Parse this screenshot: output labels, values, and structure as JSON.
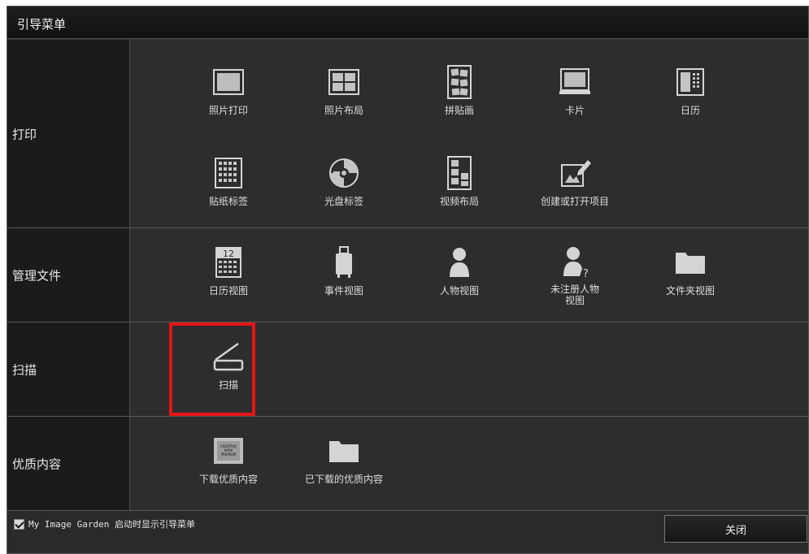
{
  "window": {
    "title": "引导菜单"
  },
  "sections": {
    "print": {
      "label": "打印",
      "items": [
        {
          "label": "照片打印",
          "icon": "photo-print-icon"
        },
        {
          "label": "照片布局",
          "icon": "photo-layout-icon"
        },
        {
          "label": "拼贴画",
          "icon": "collage-icon"
        },
        {
          "label": "卡片",
          "icon": "card-icon"
        },
        {
          "label": "日历",
          "icon": "calendar-icon"
        },
        {
          "label": "贴纸标签",
          "icon": "sticker-icon"
        },
        {
          "label": "光盘标签",
          "icon": "disc-label-icon"
        },
        {
          "label": "视频布局",
          "icon": "video-layout-icon"
        },
        {
          "label": "创建或打开项目",
          "icon": "create-open-item-icon"
        }
      ]
    },
    "manage": {
      "label": "管理文件",
      "items": [
        {
          "label": "日历视图",
          "icon": "calendar-view-icon",
          "day": "12"
        },
        {
          "label": "事件视图",
          "icon": "event-view-icon"
        },
        {
          "label": "人物视图",
          "icon": "people-view-icon"
        },
        {
          "label": "未注册人物\n视图",
          "icon": "unregistered-people-icon"
        },
        {
          "label": "文件夹视图",
          "icon": "folder-view-icon"
        }
      ]
    },
    "scan": {
      "label": "扫描",
      "items": [
        {
          "label": "扫描",
          "icon": "scan-icon"
        }
      ]
    },
    "premium": {
      "label": "优质内容",
      "items": [
        {
          "label": "下载优质内容",
          "icon": "creative-park-premium-icon",
          "logo_text": "CREATIVE PARK PREMIUM"
        },
        {
          "label": "已下载的优质内容",
          "icon": "downloaded-folder-icon"
        }
      ]
    }
  },
  "footer": {
    "startup_checkbox_label": "My Image Garden 启动时显示引导菜单",
    "startup_checked": true,
    "close_label": "关闭"
  },
  "colors": {
    "highlight": "#e41515",
    "icon": "#d4d4d4",
    "background": "#2d2d2d"
  }
}
